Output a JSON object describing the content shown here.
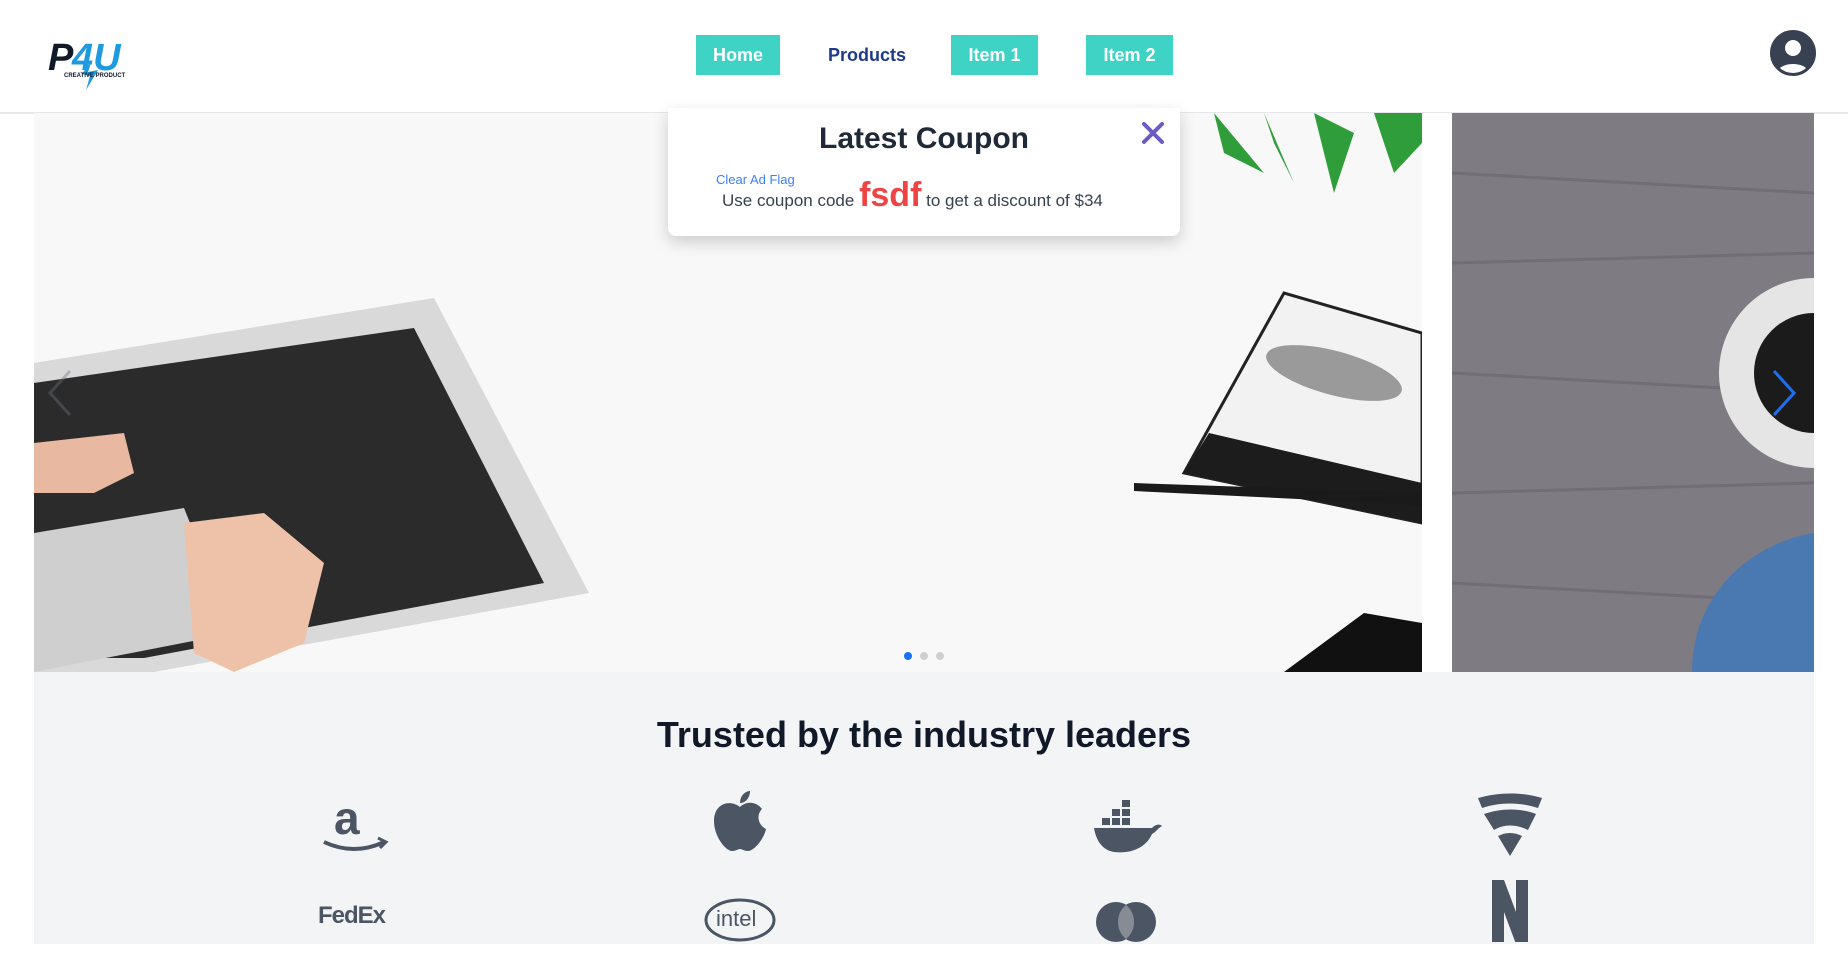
{
  "header": {
    "logo_text": "P4U",
    "logo_sub": "CREATIVE PRODUCT",
    "nav": {
      "home": "Home",
      "products": "Products",
      "item1": "Item 1",
      "item2": "Item 2"
    }
  },
  "coupon": {
    "title": "Latest Coupon",
    "clear_flag": "Clear Ad Flag",
    "text_before": "Use coupon code",
    "code": "fsdf",
    "text_after": "to get a discount of $34"
  },
  "carousel": {
    "slides": 3,
    "active_index": 0
  },
  "trusted": {
    "title": "Trusted by the industry leaders",
    "brands": [
      "amazon-icon",
      "apple-icon",
      "docker-icon",
      "fsecure-icon",
      "fedex-icon",
      "intel-icon",
      "mastercard-icon",
      "netflix-icon"
    ],
    "brand_labels": {
      "fedex": "FedEx",
      "intel": "intel"
    }
  },
  "colors": {
    "accent": "#3fd3c6",
    "nav_link": "#1e3a8a",
    "coupon_code": "#ef4444",
    "link_blue": "#3b82f6",
    "icon_gray": "#4b5563"
  }
}
